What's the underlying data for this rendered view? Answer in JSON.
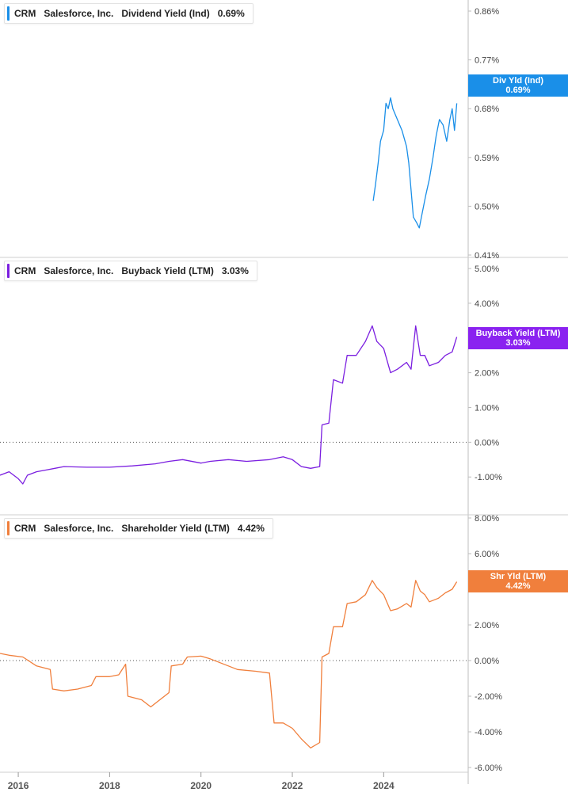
{
  "legends": [
    {
      "ticker": "CRM",
      "company": "Salesforce, Inc.",
      "metric": "Dividend Yield (Ind)",
      "value": "0.69%",
      "color": "#1a8fe8"
    },
    {
      "ticker": "CRM",
      "company": "Salesforce, Inc.",
      "metric": "Buyback Yield (LTM)",
      "value": "3.03%",
      "color": "#7b1fe0"
    },
    {
      "ticker": "CRM",
      "company": "Salesforce, Inc.",
      "metric": "Shareholder Yield (LTM)",
      "value": "4.42%",
      "color": "#f07f3c"
    }
  ],
  "tags": [
    {
      "label": "Div Yld (Ind)",
      "value": "0.69%",
      "color": "#1a8fe8"
    },
    {
      "label": "Buyback Yield (LTM)",
      "value": "3.03%",
      "color": "#8a22f0"
    },
    {
      "label": "Shr Yld (LTM)",
      "value": "4.42%",
      "color": "#f07f3c"
    }
  ],
  "chart_data": [
    {
      "type": "line",
      "title": "Dividend Yield (Ind)",
      "series": [
        {
          "name": "Dividend Yield (Ind)",
          "color": "#1a8fe8",
          "points": [
            [
              2023.77,
              0.51
            ],
            [
              2023.82,
              0.54
            ],
            [
              2023.88,
              0.58
            ],
            [
              2023.93,
              0.62
            ],
            [
              2024.0,
              0.64
            ],
            [
              2024.05,
              0.69
            ],
            [
              2024.1,
              0.68
            ],
            [
              2024.15,
              0.7
            ],
            [
              2024.2,
              0.68
            ],
            [
              2024.3,
              0.66
            ],
            [
              2024.4,
              0.64
            ],
            [
              2024.5,
              0.61
            ],
            [
              2024.55,
              0.58
            ],
            [
              2024.6,
              0.53
            ],
            [
              2024.65,
              0.48
            ],
            [
              2024.72,
              0.47
            ],
            [
              2024.78,
              0.46
            ],
            [
              2024.85,
              0.49
            ],
            [
              2024.92,
              0.52
            ],
            [
              2025.0,
              0.55
            ],
            [
              2025.08,
              0.59
            ],
            [
              2025.15,
              0.63
            ],
            [
              2025.22,
              0.66
            ],
            [
              2025.3,
              0.65
            ],
            [
              2025.38,
              0.62
            ],
            [
              2025.45,
              0.66
            ],
            [
              2025.5,
              0.68
            ],
            [
              2025.55,
              0.64
            ],
            [
              2025.6,
              0.69
            ]
          ]
        }
      ],
      "y_ticks": [
        "0.86%",
        "0.77%",
        "0.68%",
        "0.59%",
        "0.50%",
        "0.41%"
      ],
      "ylim": [
        0.41,
        0.86
      ]
    },
    {
      "type": "line",
      "title": "Buyback Yield (LTM)",
      "series": [
        {
          "name": "Buyback Yield (LTM)",
          "color": "#7b1fe0",
          "points": [
            [
              2015.6,
              -0.95
            ],
            [
              2015.8,
              -0.85
            ],
            [
              2016.0,
              -1.05
            ],
            [
              2016.1,
              -1.2
            ],
            [
              2016.2,
              -0.95
            ],
            [
              2016.4,
              -0.85
            ],
            [
              2016.6,
              -0.8
            ],
            [
              2016.8,
              -0.75
            ],
            [
              2017.0,
              -0.7
            ],
            [
              2017.5,
              -0.72
            ],
            [
              2018.0,
              -0.72
            ],
            [
              2018.5,
              -0.68
            ],
            [
              2019.0,
              -0.62
            ],
            [
              2019.3,
              -0.55
            ],
            [
              2019.6,
              -0.5
            ],
            [
              2020.0,
              -0.6
            ],
            [
              2020.2,
              -0.55
            ],
            [
              2020.6,
              -0.5
            ],
            [
              2021.0,
              -0.55
            ],
            [
              2021.5,
              -0.5
            ],
            [
              2021.8,
              -0.42
            ],
            [
              2022.0,
              -0.5
            ],
            [
              2022.2,
              -0.7
            ],
            [
              2022.4,
              -0.75
            ],
            [
              2022.6,
              -0.7
            ],
            [
              2022.65,
              0.5
            ],
            [
              2022.8,
              0.55
            ],
            [
              2022.9,
              1.8
            ],
            [
              2023.1,
              1.7
            ],
            [
              2023.2,
              2.5
            ],
            [
              2023.4,
              2.5
            ],
            [
              2023.6,
              2.9
            ],
            [
              2023.75,
              3.35
            ],
            [
              2023.85,
              2.9
            ],
            [
              2024.0,
              2.7
            ],
            [
              2024.15,
              2.0
            ],
            [
              2024.3,
              2.1
            ],
            [
              2024.5,
              2.3
            ],
            [
              2024.6,
              2.1
            ],
            [
              2024.7,
              3.35
            ],
            [
              2024.8,
              2.5
            ],
            [
              2024.9,
              2.5
            ],
            [
              2025.0,
              2.2
            ],
            [
              2025.2,
              2.3
            ],
            [
              2025.35,
              2.5
            ],
            [
              2025.5,
              2.6
            ],
            [
              2025.6,
              3.03
            ]
          ]
        }
      ],
      "y_ticks": [
        "5.00%",
        "4.00%",
        "3.00%",
        "2.00%",
        "1.00%",
        "0.00%",
        "-1.00%"
      ],
      "ylim": [
        -1.2,
        5.0
      ]
    },
    {
      "type": "line",
      "title": "Shareholder Yield (LTM)",
      "series": [
        {
          "name": "Shareholder Yield (LTM)",
          "color": "#f07f3c",
          "points": [
            [
              2015.6,
              0.4
            ],
            [
              2015.8,
              0.3
            ],
            [
              2016.1,
              0.2
            ],
            [
              2016.4,
              -0.3
            ],
            [
              2016.7,
              -0.5
            ],
            [
              2016.75,
              -1.6
            ],
            [
              2017.0,
              -1.7
            ],
            [
              2017.3,
              -1.6
            ],
            [
              2017.6,
              -1.4
            ],
            [
              2017.7,
              -0.9
            ],
            [
              2018.0,
              -0.9
            ],
            [
              2018.2,
              -0.8
            ],
            [
              2018.35,
              -0.2
            ],
            [
              2018.4,
              -2.0
            ],
            [
              2018.7,
              -2.2
            ],
            [
              2018.9,
              -2.6
            ],
            [
              2019.1,
              -2.2
            ],
            [
              2019.3,
              -1.8
            ],
            [
              2019.35,
              -0.3
            ],
            [
              2019.6,
              -0.2
            ],
            [
              2019.7,
              0.2
            ],
            [
              2020.0,
              0.25
            ],
            [
              2020.2,
              0.1
            ],
            [
              2020.6,
              -0.3
            ],
            [
              2020.8,
              -0.5
            ],
            [
              2021.2,
              -0.6
            ],
            [
              2021.5,
              -0.7
            ],
            [
              2021.6,
              -3.5
            ],
            [
              2021.8,
              -3.5
            ],
            [
              2022.0,
              -3.8
            ],
            [
              2022.2,
              -4.4
            ],
            [
              2022.4,
              -4.9
            ],
            [
              2022.6,
              -4.6
            ],
            [
              2022.65,
              0.2
            ],
            [
              2022.8,
              0.4
            ],
            [
              2022.9,
              1.9
            ],
            [
              2023.1,
              1.9
            ],
            [
              2023.2,
              3.2
            ],
            [
              2023.4,
              3.3
            ],
            [
              2023.6,
              3.7
            ],
            [
              2023.75,
              4.5
            ],
            [
              2023.85,
              4.1
            ],
            [
              2024.0,
              3.7
            ],
            [
              2024.15,
              2.8
            ],
            [
              2024.3,
              2.9
            ],
            [
              2024.5,
              3.2
            ],
            [
              2024.6,
              3.0
            ],
            [
              2024.7,
              4.5
            ],
            [
              2024.8,
              3.9
            ],
            [
              2024.9,
              3.7
            ],
            [
              2025.0,
              3.3
            ],
            [
              2025.2,
              3.5
            ],
            [
              2025.35,
              3.8
            ],
            [
              2025.5,
              4.0
            ],
            [
              2025.6,
              4.42
            ]
          ]
        }
      ],
      "y_ticks": [
        "8.00%",
        "6.00%",
        "4.00%",
        "2.00%",
        "0.00%",
        "-2.00%",
        "-4.00%",
        "-6.00%"
      ],
      "ylim": [
        -6.0,
        8.0
      ]
    }
  ],
  "x_ticks": [
    "2016",
    "2018",
    "2020",
    "2022",
    "2024"
  ]
}
